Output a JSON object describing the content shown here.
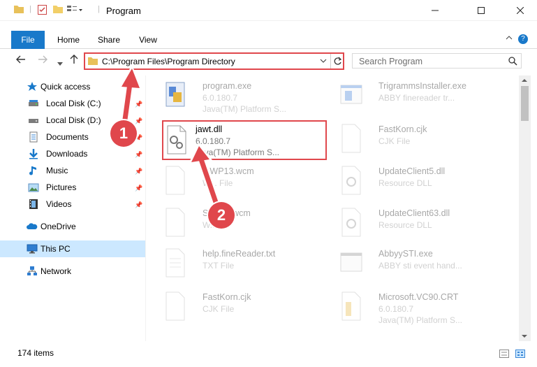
{
  "window": {
    "title": "Program"
  },
  "ribbon": {
    "tabs": [
      "File",
      "Home",
      "Share",
      "View"
    ]
  },
  "address": {
    "path": "C:\\Program Files\\Program Directory"
  },
  "search": {
    "placeholder": "Search Program"
  },
  "nav": {
    "quick_access": "Quick access",
    "items": [
      {
        "label": "Local Disk (C:)",
        "icon": "drive-icon"
      },
      {
        "label": "Local Disk (D:)",
        "icon": "drive-icon"
      },
      {
        "label": "Documents",
        "icon": "documents-icon"
      },
      {
        "label": "Downloads",
        "icon": "downloads-icon"
      },
      {
        "label": "Music",
        "icon": "music-icon"
      },
      {
        "label": "Pictures",
        "icon": "pictures-icon"
      },
      {
        "label": "Videos",
        "icon": "videos-icon"
      }
    ],
    "onedrive": "OneDrive",
    "thispc": "This PC",
    "network": "Network"
  },
  "files": {
    "left": [
      {
        "name": "program.exe",
        "line1": "6.0.180.7",
        "line2": "Java(TM) Platform S..."
      },
      {
        "name": "jawt.dll",
        "line1": "6.0.180.7",
        "line2": "Java(TM) Platform S..."
      },
      {
        "name": "...WP13.wcm",
        "line1": "W... File",
        "line2": ""
      },
      {
        "name": "Sn...15.wcm",
        "line1": "W...",
        "line2": ""
      },
      {
        "name": "help.fineReader.txt",
        "line1": "TXT File",
        "line2": ""
      },
      {
        "name": "FastKorn.cjk",
        "line1": "CJK File",
        "line2": ""
      }
    ],
    "right": [
      {
        "name": "TrigrammsInstaller.exe",
        "line1": "ABBY finereader tr...",
        "line2": ""
      },
      {
        "name": "FastKorn.cjk",
        "line1": "CJK File",
        "line2": ""
      },
      {
        "name": "UpdateClient5.dll",
        "line1": "Resource DLL",
        "line2": ""
      },
      {
        "name": "UpdateClient63.dll",
        "line1": "Resource DLL",
        "line2": ""
      },
      {
        "name": "AbbyySTI.exe",
        "line1": "ABBY sti event hand...",
        "line2": ""
      },
      {
        "name": "Microsoft.VC90.CRT",
        "line1": "6.0.180.7",
        "line2": "Java(TM) Platform S..."
      }
    ]
  },
  "status": {
    "count": "174 items"
  },
  "callouts": [
    "1",
    "2"
  ],
  "colors": {
    "accent": "#1979ca",
    "highlight": "#e0474c",
    "selected": "#cce8ff"
  }
}
